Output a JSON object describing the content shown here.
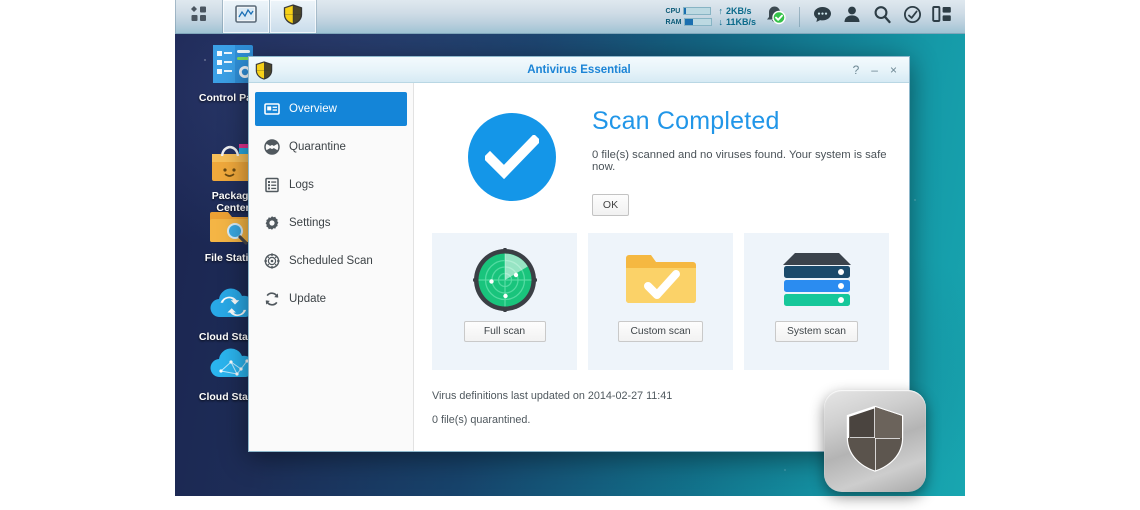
{
  "taskbar": {
    "left_buttons": [
      {
        "name": "main-menu",
        "icon": "grid-squares-icon",
        "active": false
      },
      {
        "name": "resource-monitor",
        "icon": "chart-monitor-icon",
        "active": true
      },
      {
        "name": "antivirus-essential",
        "icon": "shield-icon",
        "active": true
      }
    ],
    "resource_monitor": {
      "cpu_label": "CPU",
      "ram_label": "RAM",
      "cpu_percent": 4,
      "ram_percent": 28,
      "upload_arrow": "↑",
      "upload_speed": "2KB/s",
      "download_arrow": "↓",
      "download_speed": "11KB/s"
    },
    "right_icons": [
      {
        "name": "notification-bell-icon",
        "label": ""
      },
      {
        "name": "chat-bubble-icon",
        "label": ""
      },
      {
        "name": "user-account-icon",
        "label": ""
      },
      {
        "name": "search-icon",
        "label": ""
      },
      {
        "name": "status-check-icon",
        "label": ""
      },
      {
        "name": "widget-panel-icon",
        "label": ""
      }
    ]
  },
  "desktop": {
    "icons": [
      {
        "label": "Control Panel",
        "icon": "control-panel-icon"
      },
      {
        "label": "Package\nCenter",
        "icon": "package-center-icon"
      },
      {
        "label": "File Station",
        "icon": "file-station-icon"
      },
      {
        "label": "Cloud Station",
        "icon": "cloud-sync-icon"
      },
      {
        "label": "Cloud Station",
        "icon": "cloud-network-icon"
      }
    ],
    "icon_labels": {
      "control_panel": "Control Panel",
      "package_center_line1": "Package",
      "package_center_line2": "Center",
      "file_station": "File Station",
      "cloud_station_1": "Cloud Station",
      "cloud_station_2": "Cloud Station"
    }
  },
  "window": {
    "title": "Antivirus Essential",
    "buttons": {
      "help": "?",
      "minimize": "–",
      "close": "×"
    },
    "sidebar": {
      "items": [
        {
          "label": "Overview",
          "icon": "overview-card-icon",
          "selected": true
        },
        {
          "label": "Quarantine",
          "icon": "biohazard-icon",
          "selected": false
        },
        {
          "label": "Logs",
          "icon": "logs-list-icon",
          "selected": false
        },
        {
          "label": "Settings",
          "icon": "gear-icon",
          "selected": false
        },
        {
          "label": "Scheduled Scan",
          "icon": "target-scan-icon",
          "selected": false
        },
        {
          "label": "Update",
          "icon": "refresh-icon",
          "selected": false
        }
      ]
    },
    "content": {
      "status_title": "Scan Completed",
      "status_description": "0 file(s) scanned and no viruses found. Your system is safe now.",
      "ok_label": "OK",
      "cards": [
        {
          "label": "Full scan",
          "icon": "radar-icon"
        },
        {
          "label": "Custom scan",
          "icon": "folder-check-icon"
        },
        {
          "label": "System scan",
          "icon": "server-stack-icon"
        }
      ],
      "footer": {
        "definitions": "Virus definitions last updated on 2014-02-27 11:41",
        "quarantined": "0 file(s) quarantined."
      }
    }
  },
  "floating_icon": {
    "name": "antivirus-essential-app-icon",
    "icon": "shield-icon"
  },
  "colors": {
    "accent_blue": "#1496e8",
    "title_blue": "#1b84d6",
    "nav_selected": "#1485d8",
    "card_bg": "#eef4fa",
    "radar_green": "#1ec87f",
    "folder_yellow": "#f9ce54",
    "server_teal": "#16c79a"
  }
}
